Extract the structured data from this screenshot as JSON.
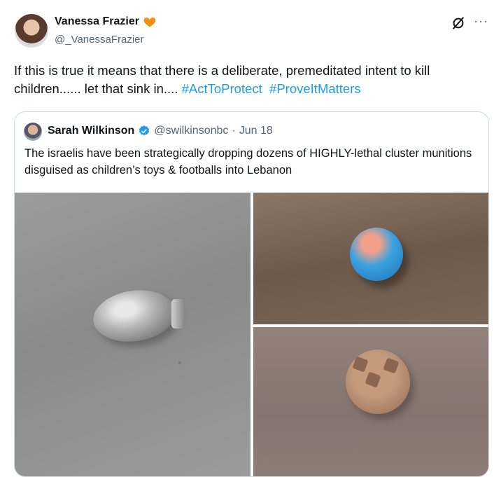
{
  "author": {
    "name": "Vanessa Frazier",
    "handle": "@_VanessaFrazier",
    "badge_color": "#f4900c"
  },
  "icons": {
    "grok": "grok-icon",
    "more": "more-icon",
    "more_glyph": "···"
  },
  "tweet": {
    "text": "If this is true it means that there is a deliberate, premeditated intent to kill children...... let that sink in.... ",
    "hashtags": [
      "#ActToProtect",
      "#ProveItMatters"
    ],
    "hashtag_color": "#1d9bf0"
  },
  "quoted": {
    "name": "Sarah Wilkinson",
    "handle": "@swilkinsonbc",
    "separator": "·",
    "date": "Jun 18",
    "verified_color": "#1d9bf0",
    "text": "The israelis have been strategically dropping dozens of HIGHLY-lethal cluster munitions disguised as children’s toys & footballs into Lebanon"
  }
}
